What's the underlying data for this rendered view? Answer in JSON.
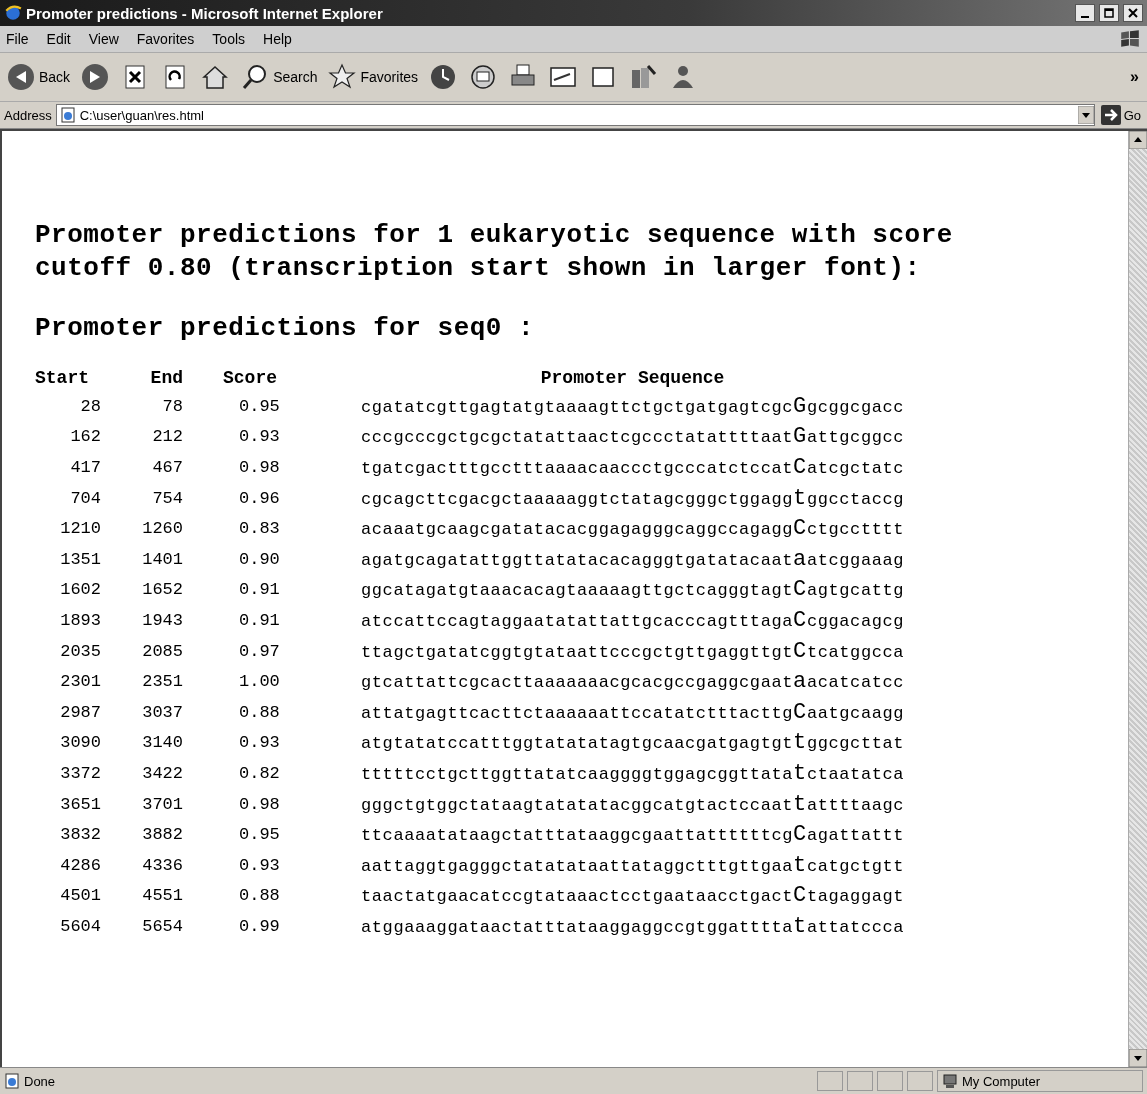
{
  "window": {
    "title": "Promoter predictions - Microsoft Internet Explorer"
  },
  "menu": [
    "File",
    "Edit",
    "View",
    "Favorites",
    "Tools",
    "Help"
  ],
  "toolbar": [
    {
      "kind": "back",
      "label": "Back"
    },
    {
      "kind": "forward"
    },
    {
      "kind": "stop"
    },
    {
      "kind": "refresh"
    },
    {
      "kind": "home"
    },
    {
      "kind": "search",
      "label": "Search"
    },
    {
      "kind": "favorites",
      "label": "Favorites"
    },
    {
      "kind": "history"
    },
    {
      "kind": "mail"
    },
    {
      "kind": "print"
    },
    {
      "kind": "edit"
    },
    {
      "kind": "discuss"
    },
    {
      "kind": "research"
    },
    {
      "kind": "messenger"
    }
  ],
  "toolbar_more": "»",
  "address": {
    "label": "Address",
    "value": "C:\\user\\guan\\res.html",
    "go": "Go"
  },
  "page": {
    "heading": "Promoter predictions for 1 eukaryotic sequence with score cutoff 0.80 (transcription start shown in larger font):",
    "subheading": "Promoter predictions for seq0 :",
    "table": {
      "columns": [
        "Start",
        "End",
        "Score",
        "Promoter Sequence"
      ],
      "rows": [
        {
          "start": "28",
          "end": "78",
          "score": "0.95",
          "before": "cgatatcgttgagtatgtaaaagttctgctgatgagtcgc",
          "tss": "G",
          "after": "gcggcgacc"
        },
        {
          "start": "162",
          "end": "212",
          "score": "0.93",
          "before": "cccgcccgctgcgctatattaactcgccctatattttaat",
          "tss": "G",
          "after": "attgcggcc"
        },
        {
          "start": "417",
          "end": "467",
          "score": "0.98",
          "before": "tgatcgactttgcctttaaaacaaccctgcccatctccat",
          "tss": "C",
          "after": "atcgctatc"
        },
        {
          "start": "704",
          "end": "754",
          "score": "0.96",
          "before": "cgcagcttcgacgctaaaaaggtctatagcgggctggagg",
          "tss": "t",
          "after": "ggcctaccg"
        },
        {
          "start": "1210",
          "end": "1260",
          "score": "0.83",
          "before": "acaaatgcaagcgatatacacggagagggcaggccagagg",
          "tss": "C",
          "after": "ctgcctttt"
        },
        {
          "start": "1351",
          "end": "1401",
          "score": "0.90",
          "before": "agatgcagatattggttatatacacagggtgatatacaat",
          "tss": "a",
          "after": "atcggaaag"
        },
        {
          "start": "1602",
          "end": "1652",
          "score": "0.91",
          "before": "ggcatagatgtaaacacagtaaaaagttgctcagggtagt",
          "tss": "C",
          "after": "agtgcattg"
        },
        {
          "start": "1893",
          "end": "1943",
          "score": "0.91",
          "before": "atccattccagtaggaatatattattgcacccagtttaga",
          "tss": "C",
          "after": "cggacagcg"
        },
        {
          "start": "2035",
          "end": "2085",
          "score": "0.97",
          "before": "ttagctgatatcggtgtataattcccgctgttgaggttgt",
          "tss": "C",
          "after": "tcatggcca"
        },
        {
          "start": "2301",
          "end": "2351",
          "score": "1.00",
          "before": "gtcattattcgcacttaaaaaaacgcacgccgaggcgaat",
          "tss": "a",
          "after": "acatcatcc"
        },
        {
          "start": "2987",
          "end": "3037",
          "score": "0.88",
          "before": "attatgagttcacttctaaaaaattccatatctttacttg",
          "tss": "C",
          "after": "aatgcaagg"
        },
        {
          "start": "3090",
          "end": "3140",
          "score": "0.93",
          "before": "atgtatatccatttggtatatatagtgcaacgatgagtgt",
          "tss": "t",
          "after": "ggcgcttat"
        },
        {
          "start": "3372",
          "end": "3422",
          "score": "0.82",
          "before": "tttttcctgcttggttatatcaaggggtggagcggttata",
          "tss": "t",
          "after": "ctaatatca"
        },
        {
          "start": "3651",
          "end": "3701",
          "score": "0.98",
          "before": "gggctgtggctataagtatatatacggcatgtactccaat",
          "tss": "t",
          "after": "attttaagc"
        },
        {
          "start": "3832",
          "end": "3882",
          "score": "0.95",
          "before": "ttcaaaatataagctatttataaggcgaattattttttcg",
          "tss": "C",
          "after": "agattattt"
        },
        {
          "start": "4286",
          "end": "4336",
          "score": "0.93",
          "before": "aattaggtgagggctatatataattataggctttgttgaa",
          "tss": "t",
          "after": "catgctgtt"
        },
        {
          "start": "4501",
          "end": "4551",
          "score": "0.88",
          "before": "taactatgaacatccgtataaactcctgaataacctgact",
          "tss": "C",
          "after": "tagaggagt"
        },
        {
          "start": "5604",
          "end": "5654",
          "score": "0.99",
          "before": "atggaaaggataactatttataaggaggccgtggatttta",
          "tss": "t",
          "after": "attatccca"
        }
      ]
    }
  },
  "status_bar": {
    "text": "Done",
    "zone": "My Computer"
  }
}
